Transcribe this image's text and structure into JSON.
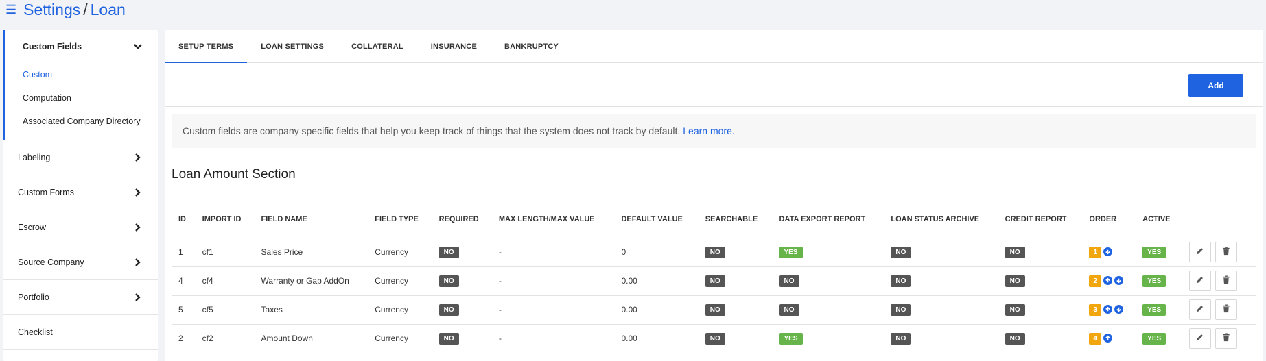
{
  "header": {
    "title": "Settings",
    "separator": "/",
    "subtitle": "Loan"
  },
  "sidebar": {
    "group": {
      "label": "Custom Fields",
      "items": [
        {
          "label": "Custom",
          "active": true
        },
        {
          "label": "Computation",
          "active": false
        },
        {
          "label": "Associated Company Directory",
          "active": false
        }
      ]
    },
    "items": [
      {
        "label": "Labeling",
        "has_chevron": true
      },
      {
        "label": "Custom Forms",
        "has_chevron": true
      },
      {
        "label": "Escrow",
        "has_chevron": true
      },
      {
        "label": "Source Company",
        "has_chevron": true
      },
      {
        "label": "Portfolio",
        "has_chevron": true
      },
      {
        "label": "Checklist",
        "has_chevron": false
      }
    ]
  },
  "tabs": [
    {
      "label": "SETUP TERMS",
      "active": true
    },
    {
      "label": "LOAN SETTINGS",
      "active": false
    },
    {
      "label": "COLLATERAL",
      "active": false
    },
    {
      "label": "INSURANCE",
      "active": false
    },
    {
      "label": "BANKRUPTCY",
      "active": false
    }
  ],
  "toolbar": {
    "add_label": "Add"
  },
  "info": {
    "text": "Custom fields are company specific fields that help you keep track of things that the system does not track by default.",
    "link": "Learn more."
  },
  "section_title": "Loan Amount Section",
  "table": {
    "headers": [
      "ID",
      "IMPORT ID",
      "FIELD NAME",
      "FIELD TYPE",
      "REQUIRED",
      "MAX LENGTH/MAX VALUE",
      "DEFAULT VALUE",
      "SEARCHABLE",
      "DATA EXPORT REPORT",
      "LOAN STATUS ARCHIVE",
      "CREDIT REPORT",
      "ORDER",
      "ACTIVE",
      ""
    ],
    "rows": [
      {
        "id": "1",
        "import_id": "cf1",
        "field_name": "Sales Price",
        "field_type": "Currency",
        "required": "NO",
        "max": "-",
        "default": "0",
        "searchable": "NO",
        "export": "YES",
        "archive": "NO",
        "credit": "NO",
        "order": "1",
        "up": false,
        "down": true,
        "active": "YES"
      },
      {
        "id": "4",
        "import_id": "cf4",
        "field_name": "Warranty or Gap AddOn",
        "field_type": "Currency",
        "required": "NO",
        "max": "-",
        "default": "0.00",
        "searchable": "NO",
        "export": "NO",
        "archive": "NO",
        "credit": "NO",
        "order": "2",
        "up": true,
        "down": true,
        "active": "YES"
      },
      {
        "id": "5",
        "import_id": "cf5",
        "field_name": "Taxes",
        "field_type": "Currency",
        "required": "NO",
        "max": "-",
        "default": "0.00",
        "searchable": "NO",
        "export": "NO",
        "archive": "NO",
        "credit": "NO",
        "order": "3",
        "up": true,
        "down": true,
        "active": "YES"
      },
      {
        "id": "2",
        "import_id": "cf2",
        "field_name": "Amount Down",
        "field_type": "Currency",
        "required": "NO",
        "max": "-",
        "default": "0.00",
        "searchable": "NO",
        "export": "YES",
        "archive": "NO",
        "credit": "NO",
        "order": "4",
        "up": true,
        "down": false,
        "active": "YES"
      }
    ]
  },
  "colors": {
    "accent": "#1f63e0",
    "yes": "#67b54a",
    "no": "#555555",
    "order": "#f2a60d"
  },
  "icons": {
    "menu": "hamburger-icon",
    "chevron_down": "chevron-down-icon",
    "chevron_right": "chevron-right-icon",
    "edit": "pencil-icon",
    "delete": "trash-icon",
    "up": "arrow-up-circle-icon",
    "down": "arrow-down-circle-icon"
  }
}
